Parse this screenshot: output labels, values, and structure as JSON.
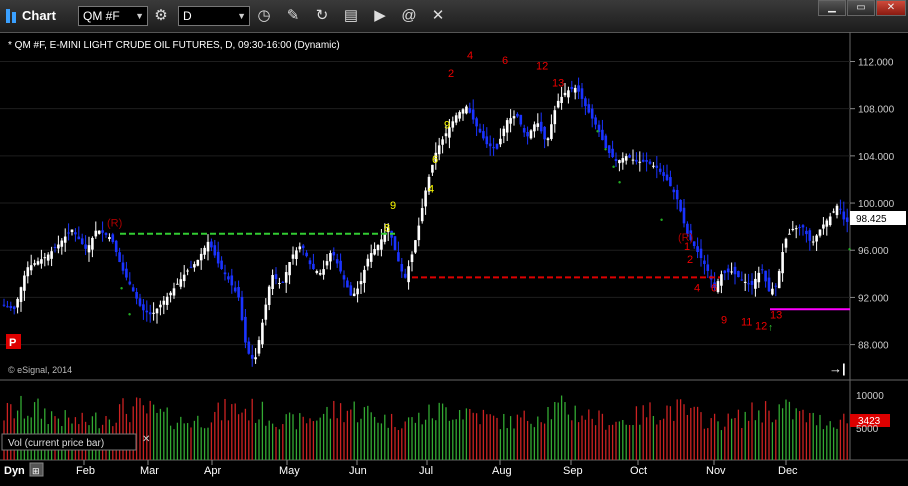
{
  "window": {
    "title": "Chart",
    "symbol": "QM #F",
    "interval": "D",
    "minimize_icon": "minimize-icon",
    "maximize_icon": "maximize-icon",
    "close_icon": "close-icon"
  },
  "toolbar": {
    "icons": [
      "link-icon",
      "clock-icon",
      "pencil-icon",
      "refresh-icon",
      "tape-icon",
      "play-icon",
      "at-icon",
      "tools-icon"
    ]
  },
  "chart": {
    "header": "* QM #F, E-MINI LIGHT CRUDE OIL FUTURES, D, 09:30-16:00 (Dynamic)",
    "copyright": "© eSignal, 2014",
    "last_price": "98.425",
    "p_badge": "P",
    "colors": {
      "up": "#ffffff",
      "down": "#1a33ff",
      "support": "#33cc33",
      "resistance": "#dd0000",
      "magenta": "#ff00ff",
      "setup_buy": "#22aa22",
      "setup_sell": "#ee0000",
      "count_yellow": "#ffff00"
    }
  },
  "volume_panel": {
    "label": "Vol (current price bar)",
    "last_volume": "3423",
    "y_ticks": [
      "10000",
      "5000"
    ]
  },
  "x_axis": {
    "prefix": "Dyn",
    "months": [
      "Feb",
      "Mar",
      "Apr",
      "May",
      "Jun",
      "Jul",
      "Aug",
      "Sep",
      "Oct",
      "Nov",
      "Dec"
    ]
  },
  "chart_data": {
    "type": "candlestick",
    "title": "* QM #F, E-MINI LIGHT CRUDE OIL FUTURES, D, 09:30-16:00 (Dynamic)",
    "y_ticks": [
      88,
      92,
      96,
      100,
      104,
      108,
      112
    ],
    "ylim": [
      85,
      114.5
    ],
    "x_months": [
      "Feb",
      "Mar",
      "Apr",
      "May",
      "Jun",
      "Jul",
      "Aug",
      "Sep",
      "Oct",
      "Nov",
      "Dec"
    ],
    "last_price": 98.425,
    "support_line": {
      "value": 97.4,
      "color": "#33cc33"
    },
    "resistance_line": {
      "value": 93.7,
      "color": "#dd0000"
    },
    "magenta_line": {
      "value": 91.0
    },
    "price_path": [
      [
        0,
        91.5
      ],
      [
        18,
        91.0
      ],
      [
        30,
        94.5
      ],
      [
        50,
        95.5
      ],
      [
        62,
        96.5
      ],
      [
        75,
        97.8
      ],
      [
        90,
        96.0
      ],
      [
        100,
        97.8
      ],
      [
        115,
        97.0
      ],
      [
        125,
        94.5
      ],
      [
        135,
        92.8
      ],
      [
        145,
        91.0
      ],
      [
        155,
        90.5
      ],
      [
        165,
        91.5
      ],
      [
        175,
        92.5
      ],
      [
        190,
        94.2
      ],
      [
        200,
        95.0
      ],
      [
        212,
        96.8
      ],
      [
        222,
        94.8
      ],
      [
        232,
        93.5
      ],
      [
        242,
        92.0
      ],
      [
        250,
        87.5
      ],
      [
        258,
        86.5
      ],
      [
        265,
        89.5
      ],
      [
        275,
        94.0
      ],
      [
        285,
        93.0
      ],
      [
        295,
        95.5
      ],
      [
        305,
        96.5
      ],
      [
        315,
        94.5
      ],
      [
        325,
        94.0
      ],
      [
        335,
        96.0
      ],
      [
        345,
        94.0
      ],
      [
        355,
        92.0
      ],
      [
        363,
        93.0
      ],
      [
        372,
        95.5
      ],
      [
        382,
        96.5
      ],
      [
        392,
        98.0
      ],
      [
        400,
        95.5
      ],
      [
        408,
        93.5
      ],
      [
        415,
        95.5
      ],
      [
        422,
        98.0
      ],
      [
        430,
        101.5
      ],
      [
        440,
        104.5
      ],
      [
        450,
        106.0
      ],
      [
        460,
        107.5
      ],
      [
        470,
        108.2
      ],
      [
        480,
        106.5
      ],
      [
        490,
        105.0
      ],
      [
        500,
        104.5
      ],
      [
        510,
        107.0
      ],
      [
        520,
        107.5
      ],
      [
        530,
        105.5
      ],
      [
        540,
        107.0
      ],
      [
        550,
        105.0
      ],
      [
        560,
        108.5
      ],
      [
        570,
        109.5
      ],
      [
        580,
        109.8
      ],
      [
        590,
        108.0
      ],
      [
        600,
        106.5
      ],
      [
        610,
        104.5
      ],
      [
        620,
        103.5
      ],
      [
        630,
        104.0
      ],
      [
        640,
        103.5
      ],
      [
        650,
        103.5
      ],
      [
        660,
        103.0
      ],
      [
        670,
        102.0
      ],
      [
        680,
        100.5
      ],
      [
        690,
        97.5
      ],
      [
        700,
        96.0
      ],
      [
        710,
        94.5
      ],
      [
        718,
        92.8
      ],
      [
        725,
        94.0
      ],
      [
        735,
        94.2
      ],
      [
        745,
        93.5
      ],
      [
        755,
        93.0
      ],
      [
        765,
        94.5
      ],
      [
        772,
        92.5
      ],
      [
        780,
        93.0
      ],
      [
        788,
        96.8
      ],
      [
        796,
        97.8
      ],
      [
        806,
        98.0
      ],
      [
        815,
        96.5
      ],
      [
        825,
        98.0
      ],
      [
        835,
        99.0
      ],
      [
        842,
        100.0
      ],
      [
        848,
        98.4
      ]
    ],
    "annotations": [
      {
        "text": "(R)",
        "x": 107,
        "y": 98.0,
        "color": "#aa0000"
      },
      {
        "text": "(R)",
        "x": 678,
        "y": 96.8,
        "color": "#aa0000"
      },
      {
        "text": "2",
        "x": 448,
        "y": 110.7,
        "color": "#ee0000"
      },
      {
        "text": "4",
        "x": 467,
        "y": 112.2,
        "color": "#ee0000"
      },
      {
        "text": "6",
        "x": 502,
        "y": 111.8,
        "color": "#ee0000"
      },
      {
        "text": "12",
        "x": 536,
        "y": 111.3,
        "color": "#ee0000"
      },
      {
        "text": "13",
        "x": 552,
        "y": 109.9,
        "color": "#ee0000"
      },
      {
        "text": "1",
        "x": 684,
        "y": 96.0,
        "color": "#ee0000"
      },
      {
        "text": "2",
        "x": 687,
        "y": 94.9,
        "color": "#ee0000"
      },
      {
        "text": "4",
        "x": 694,
        "y": 92.5,
        "color": "#ee0000"
      },
      {
        "text": "6",
        "x": 711,
        "y": 92.5,
        "color": "#ee0000"
      },
      {
        "text": "9",
        "x": 721,
        "y": 89.8,
        "color": "#ee0000"
      },
      {
        "text": "11",
        "x": 741,
        "y": 89.6,
        "color": "#ee0000"
      },
      {
        "text": "12",
        "x": 755,
        "y": 89.3,
        "color": "#ee0000"
      },
      {
        "text": "13",
        "x": 770,
        "y": 90.2,
        "color": "#ee0000"
      },
      {
        "text": "9",
        "x": 390,
        "y": 99.5,
        "color": "#ffff00"
      },
      {
        "text": "9",
        "x": 444,
        "y": 106.3,
        "color": "#ffff00"
      },
      {
        "text": "6",
        "x": 432,
        "y": 103.4,
        "color": "#ffff00"
      },
      {
        "text": "4",
        "x": 428,
        "y": 100.9,
        "color": "#ffff00"
      },
      {
        "text": "8",
        "x": 384,
        "y": 97.6,
        "color": "#ffff00"
      }
    ]
  }
}
